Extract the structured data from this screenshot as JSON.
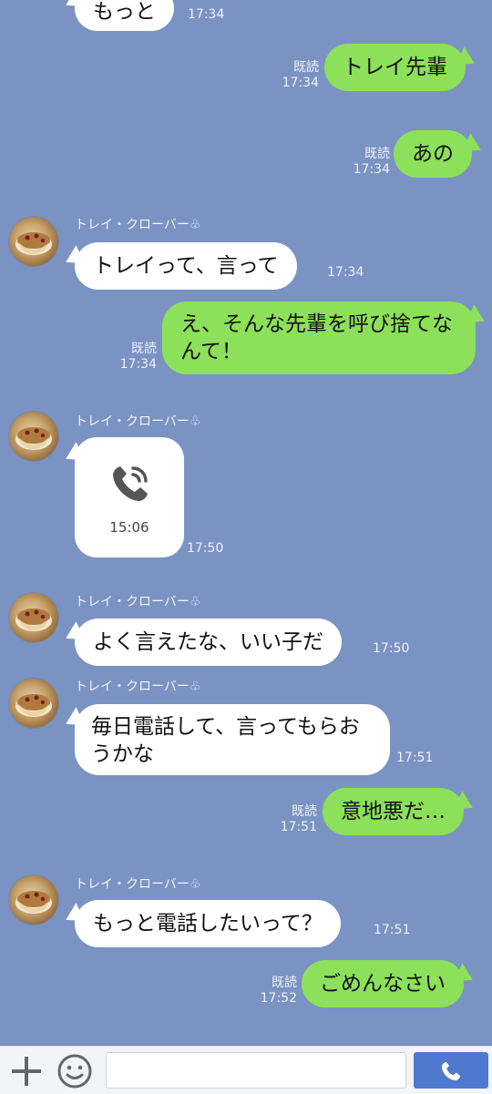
{
  "contact": {
    "name": "トレイ・クローバー♧"
  },
  "read_label": "既読",
  "messages": [
    {
      "id": "m1",
      "side": "in",
      "text": "もっと",
      "time": "17:34"
    },
    {
      "id": "m2",
      "side": "out",
      "text": "トレイ先輩",
      "time": "17:34",
      "read": "既読"
    },
    {
      "id": "m3",
      "side": "out",
      "text": "あの",
      "time": "17:34",
      "read": "既読"
    },
    {
      "id": "m4",
      "side": "in",
      "sender": "トレイ・クローバー♧",
      "text": "トレイって、言って",
      "time": "17:34"
    },
    {
      "id": "m5",
      "side": "out",
      "text": "え、そんな先輩を呼び捨てなんて！",
      "time": "17:34",
      "read": "既読"
    },
    {
      "id": "m6",
      "side": "in",
      "sender": "トレイ・クローバー♧",
      "type": "call",
      "call_duration": "15:06",
      "time": "17:50",
      "icon": "phone-icon"
    },
    {
      "id": "m7",
      "side": "in",
      "sender": "トレイ・クローバー♧",
      "text": "よく言えたな、いい子だ",
      "time": "17:50"
    },
    {
      "id": "m8",
      "side": "in",
      "sender": "トレイ・クローバー♧",
      "text": "毎日電話して、言ってもらおうかな",
      "time": "17:51"
    },
    {
      "id": "m9",
      "side": "out",
      "text": "意地悪だ…",
      "time": "17:51",
      "read": "既読"
    },
    {
      "id": "m10",
      "side": "in",
      "sender": "トレイ・クローバー♧",
      "text": "もっと電話したいって？",
      "time": "17:51"
    },
    {
      "id": "m11",
      "side": "out",
      "text": "ごめんなさい",
      "time": "17:52",
      "read": "既読"
    }
  ],
  "input_bar": {
    "plus_icon": "plus-icon",
    "sticker_icon": "smiley-icon",
    "input_value": "",
    "input_placeholder": "",
    "send_icon": "phone-icon"
  },
  "colors": {
    "background": "#7b93c3",
    "outgoing_bubble": "#8de05a",
    "incoming_bubble": "#ffffff",
    "send_button": "#4f79cf"
  }
}
